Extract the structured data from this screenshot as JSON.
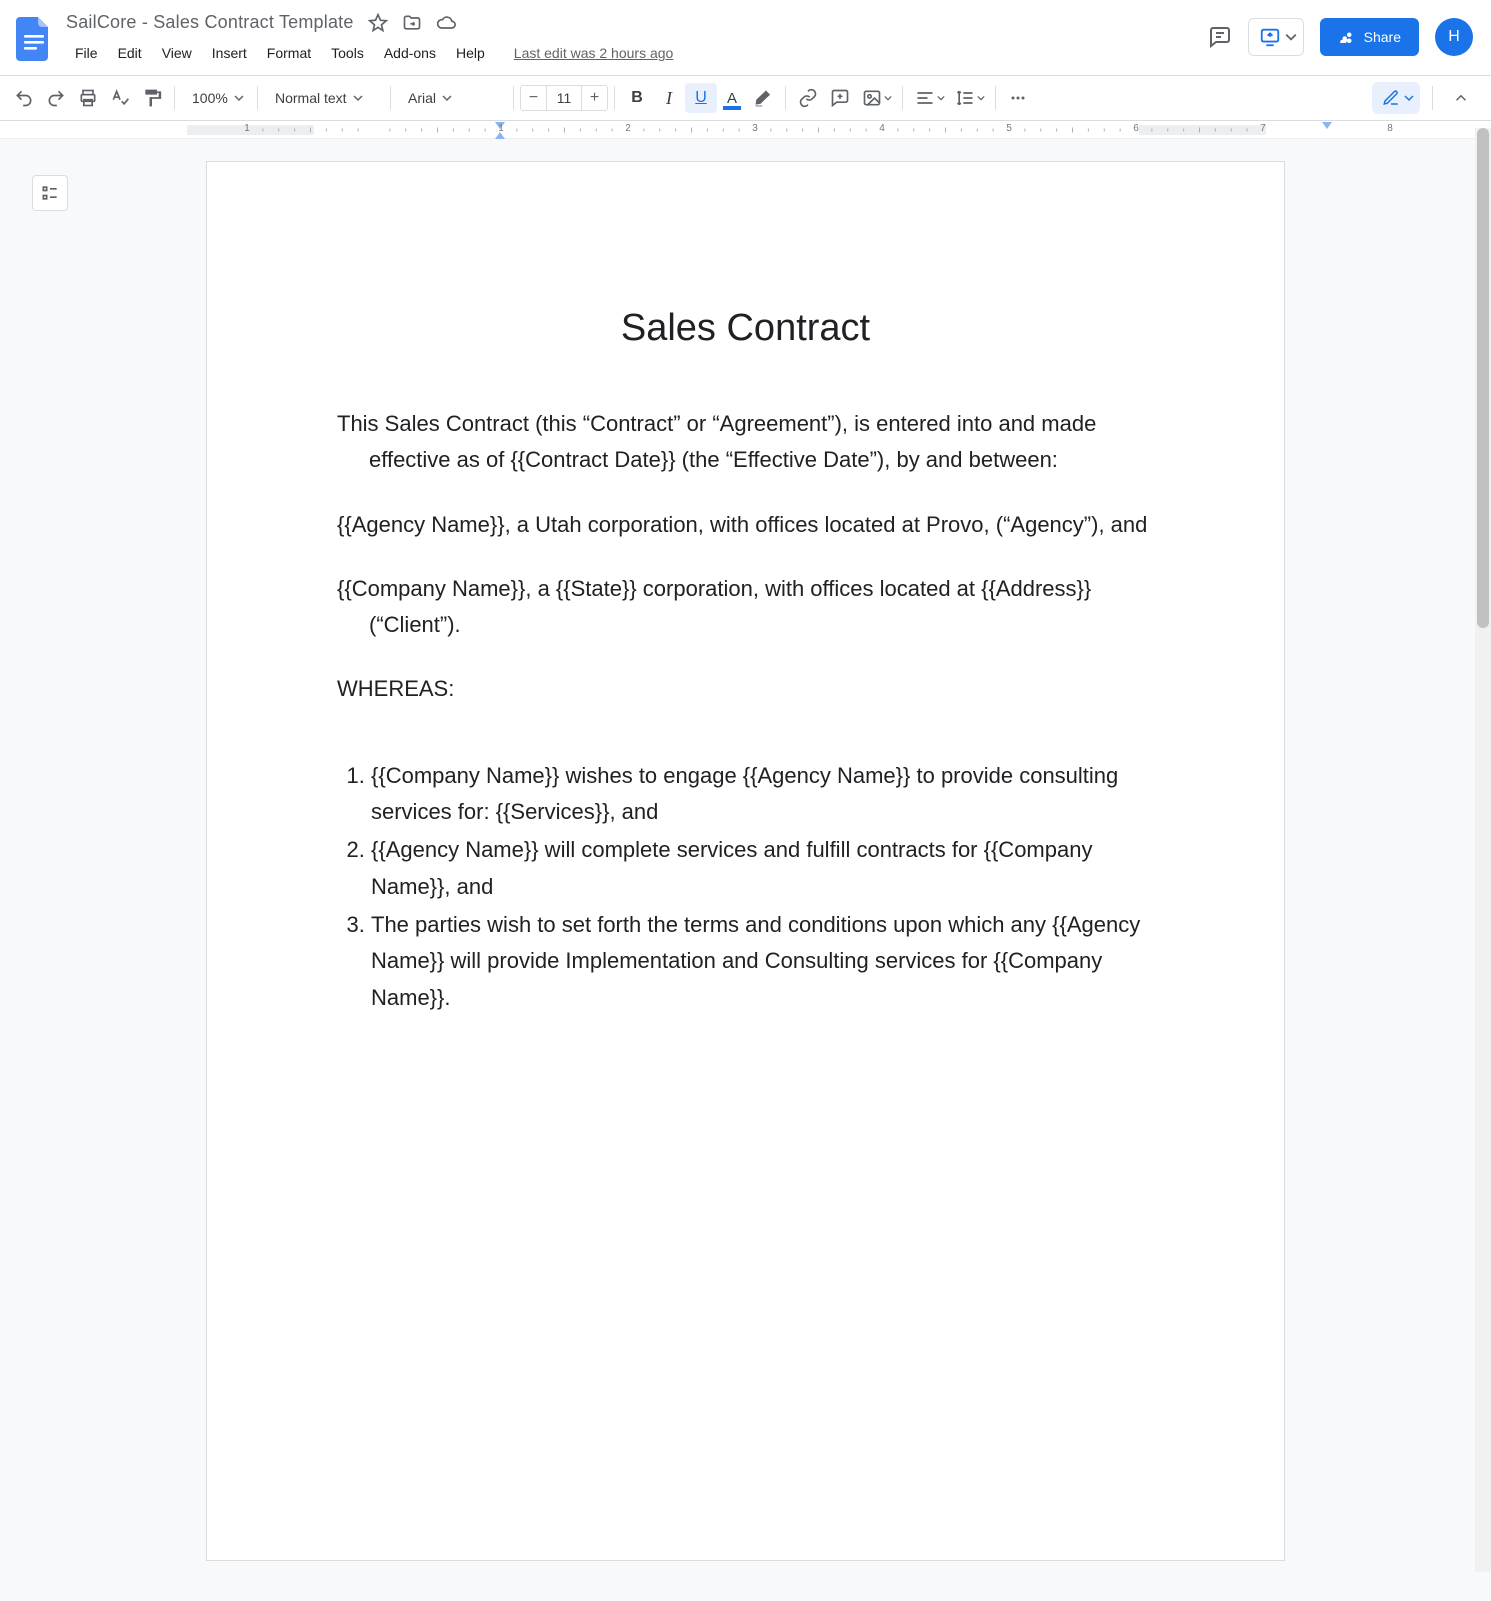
{
  "header": {
    "doc_title": "SailCore - Sales Contract Template",
    "last_edit": "Last edit was 2 hours ago",
    "menus": [
      "File",
      "Edit",
      "View",
      "Insert",
      "Format",
      "Tools",
      "Add-ons",
      "Help"
    ],
    "share_label": "Share",
    "avatar_initial": "H"
  },
  "toolbar": {
    "zoom": "100%",
    "paragraph_style": "Normal text",
    "font_family": "Arial",
    "font_size": "11"
  },
  "ruler": {
    "numbers": [
      "1",
      "1",
      "2",
      "3",
      "4",
      "5",
      "6",
      "7",
      "8"
    ]
  },
  "document": {
    "title": "Sales Contract",
    "p1": "This Sales Contract (this “Contract” or “Agreement”), is entered into and made effective as of {{Contract Date}} (the “Effective Date”), by and between:",
    "p2": "{{Agency Name}}, a Utah corporation, with offices located at Provo, (“Agency”), and",
    "p3": "{{Company Name}}, a {{State}} corporation, with offices located at {{Address}}  (“Client”).",
    "p4": "WHEREAS:",
    "list": [
      "{{Company Name}} wishes to engage {{Agency Name}} to provide consulting services for: {{Services}}, and",
      "{{Agency Name}} will complete services and fulfill contracts for {{Company Name}}, and",
      "The parties wish to set forth the terms and conditions upon which any {{Agency Name}} will provide Implementation and Consulting services for {{Company Name}}."
    ]
  }
}
